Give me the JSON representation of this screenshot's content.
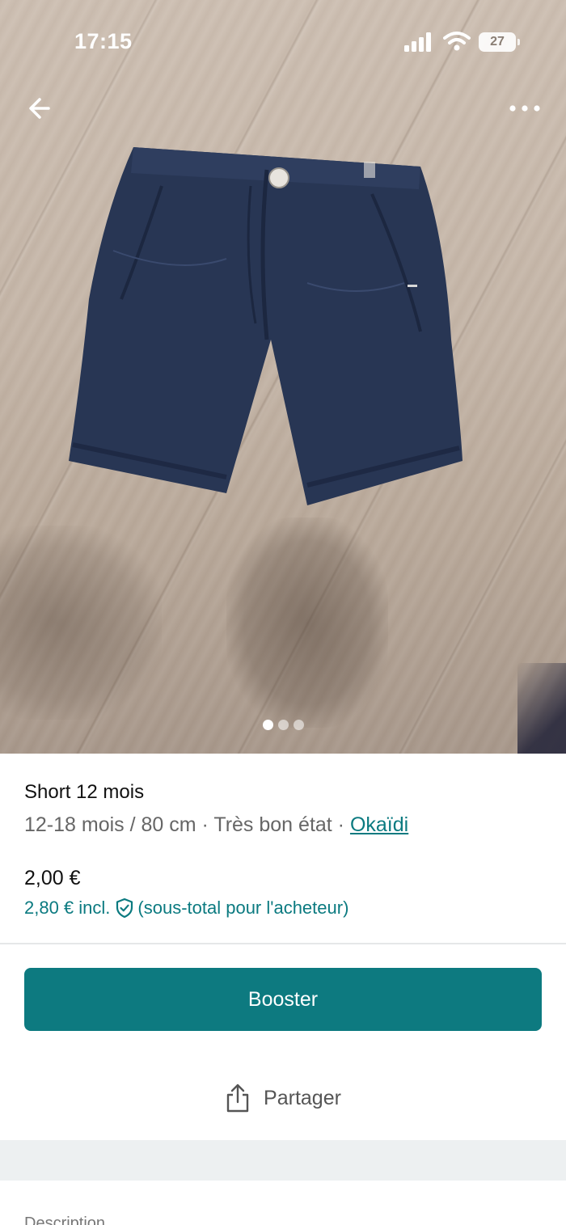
{
  "status_bar": {
    "time": "17:15",
    "battery": "27"
  },
  "item": {
    "title": "Short 12 mois",
    "size": "12-18 mois / 80 cm",
    "separator": " · ",
    "condition": "Très bon état",
    "brand": "Okaïdi",
    "price": "2,00 €",
    "price_incl": "2,80 € incl.",
    "price_incl_note": "(sous-total pour l'acheteur)"
  },
  "gallery": {
    "photo_count": 3,
    "active_index": 0
  },
  "actions": {
    "booster_label": "Booster",
    "share_label": "Partager"
  },
  "description": {
    "heading": "Description"
  },
  "colors": {
    "accent": "#0d7a80",
    "shorts": "#283654"
  },
  "icons": {
    "back": "arrow-left-icon",
    "more": "more-horizontal-icon",
    "shield": "shield-check-icon",
    "share": "share-icon",
    "signal": "signal-icon",
    "wifi": "wifi-icon",
    "battery": "battery-icon"
  }
}
